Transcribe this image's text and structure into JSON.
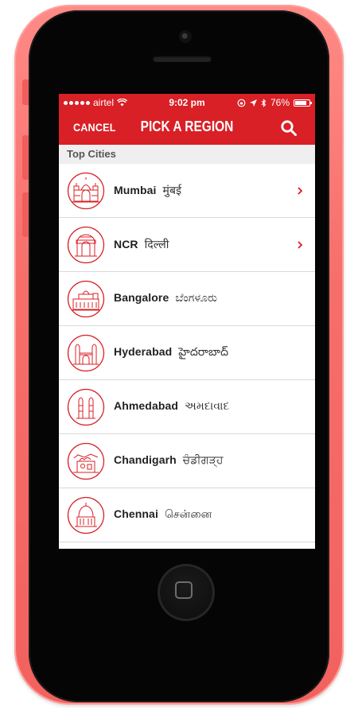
{
  "status_bar": {
    "carrier": "airtel",
    "time": "9:02 pm",
    "battery": "76%"
  },
  "nav": {
    "cancel_label": "CANCEL",
    "title": "PICK A REGION"
  },
  "section": {
    "title": "Top Cities"
  },
  "cities": [
    {
      "name": "Mumbai",
      "native": "मुंबई",
      "has_chevron": true
    },
    {
      "name": "NCR",
      "native": "दिल्ली",
      "has_chevron": true
    },
    {
      "name": "Bangalore",
      "native": "ಬೆಂಗಳೂರು",
      "has_chevron": false
    },
    {
      "name": "Hyderabad",
      "native": "హైదరాబాద్",
      "has_chevron": false
    },
    {
      "name": "Ahmedabad",
      "native": "અમદાવાદ",
      "has_chevron": false
    },
    {
      "name": "Chandigarh",
      "native": "ਚੰਡੀਗੜ੍ਹ",
      "has_chevron": false
    },
    {
      "name": "Chennai",
      "native": "சென்னை",
      "has_chevron": false
    }
  ],
  "colors": {
    "accent": "#d82026",
    "phone_body": "#f66e6a",
    "section_bg": "#efefef"
  },
  "icons": {
    "search": "search-icon",
    "chevron": "chevron-right-icon",
    "camera": "camera-icon",
    "home": "home-button-icon"
  }
}
